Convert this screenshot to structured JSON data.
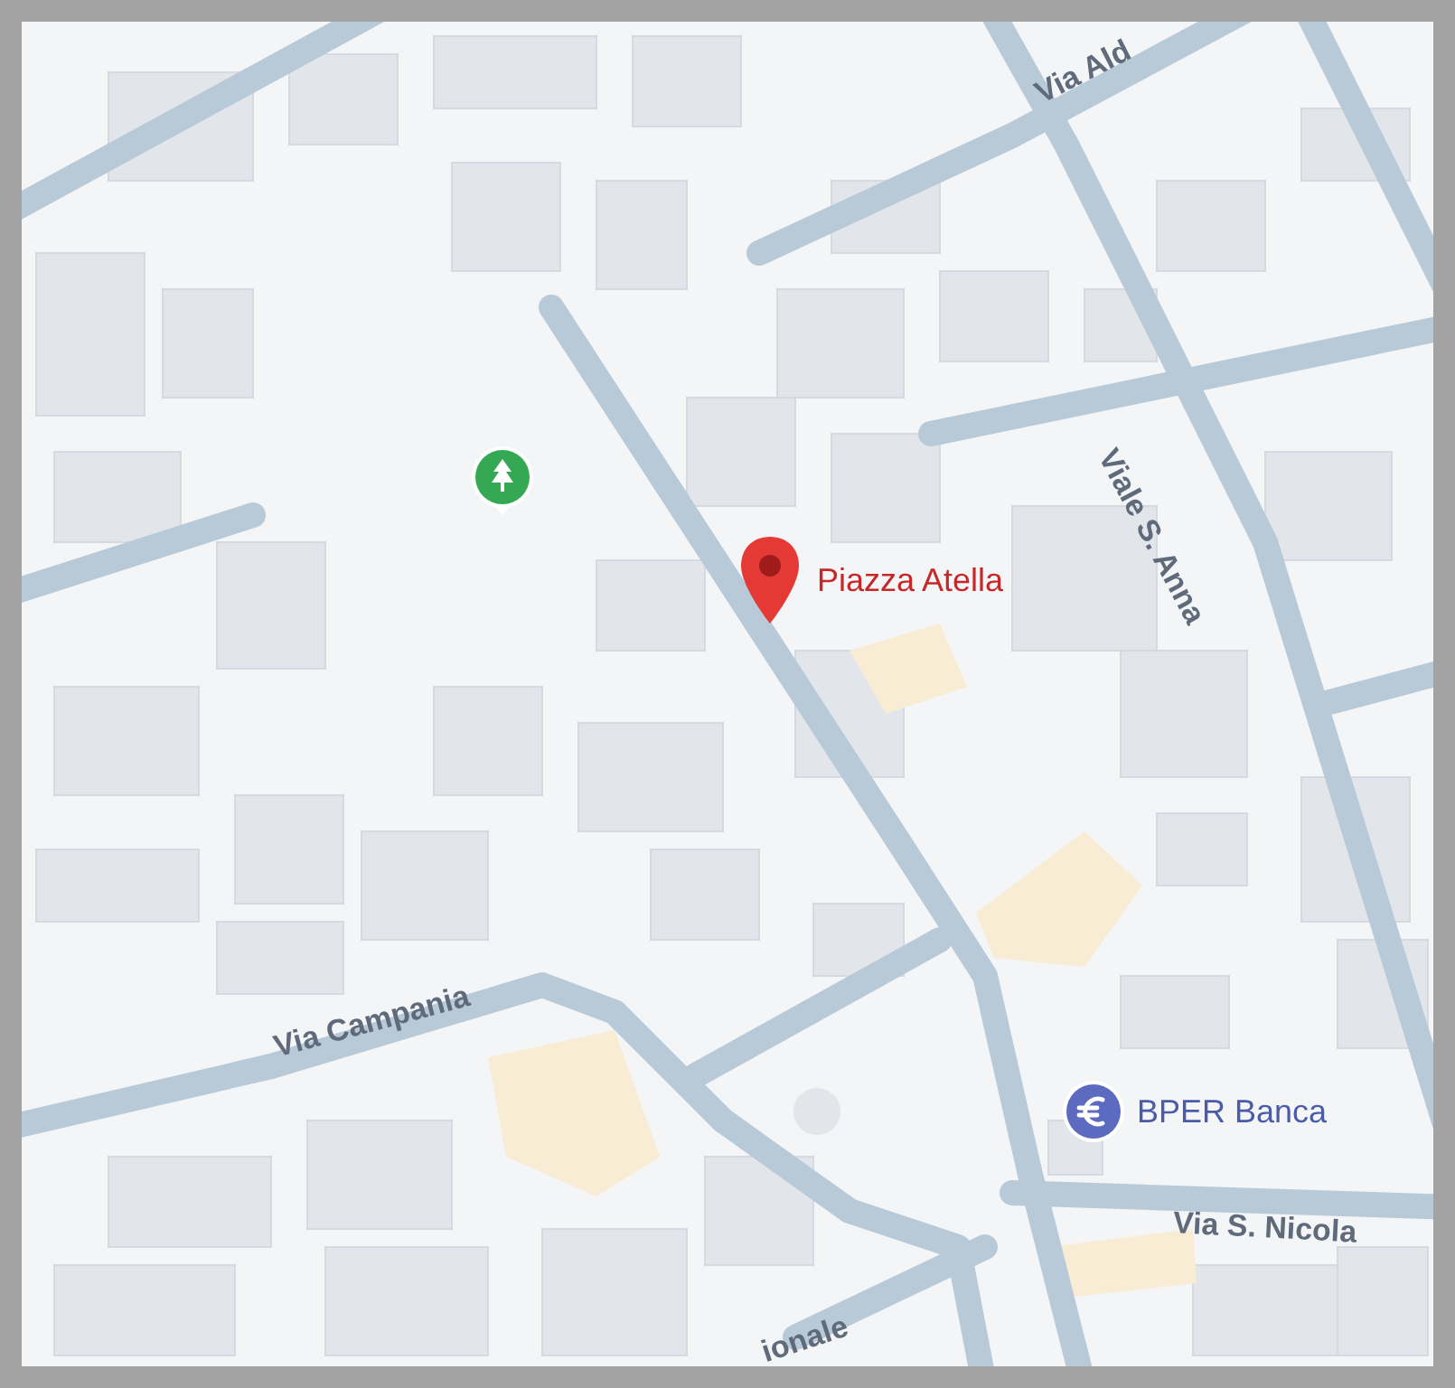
{
  "map": {
    "streets": [
      {
        "name": "Via Ald",
        "kind": "street"
      },
      {
        "name": "Viale S. Anna",
        "kind": "street"
      },
      {
        "name": "Via Campania",
        "kind": "street"
      },
      {
        "name": "Via S. Nicola",
        "kind": "street"
      },
      {
        "name": "ionale",
        "kind": "street"
      }
    ],
    "places": [
      {
        "name": "Piazza Atella",
        "kind": "pin"
      },
      {
        "name": "BPER Banca",
        "kind": "bank"
      }
    ],
    "pois": [
      {
        "kind": "park"
      }
    ]
  }
}
